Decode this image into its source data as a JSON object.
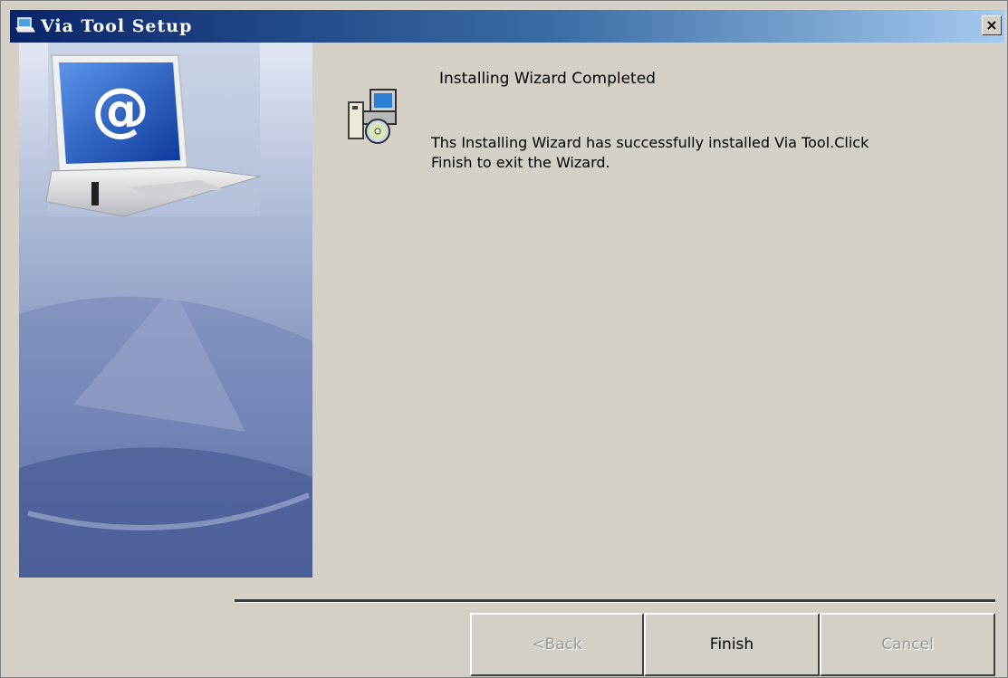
{
  "window": {
    "title": "Via Tool Setup",
    "close_label": "×"
  },
  "content": {
    "heading": "Installing Wizard Completed",
    "message": "Ths  Installing  Wizard  has  successfully  installed Via Tool.Click Finish to exit the Wizard."
  },
  "buttons": {
    "back": {
      "label": "<Back",
      "enabled": false
    },
    "finish": {
      "label": "Finish",
      "enabled": true
    },
    "cancel": {
      "label": "Cancel",
      "enabled": false
    }
  },
  "graphics": {
    "side_image": "laptop-at-sign-illustration",
    "wizard_icon": "installer-cd-computer-icon"
  }
}
